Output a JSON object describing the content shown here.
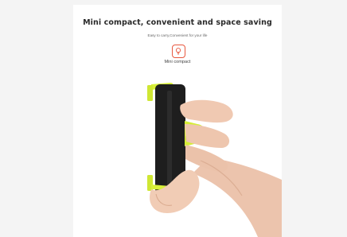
{
  "headline": "Mini compact, convenient and space saving",
  "subheadline": "Easy to carry,Convenient for your life",
  "feature": {
    "label": "Mini compact",
    "icon": "lightbulb-icon",
    "icon_color": "#e8583f"
  },
  "colors": {
    "page_background": "#f4f4f4",
    "panel_background": "#ffffff",
    "accent_lime": "#d9f23a",
    "holder_black": "#1e1e1e",
    "skin": "#efc8b0"
  }
}
